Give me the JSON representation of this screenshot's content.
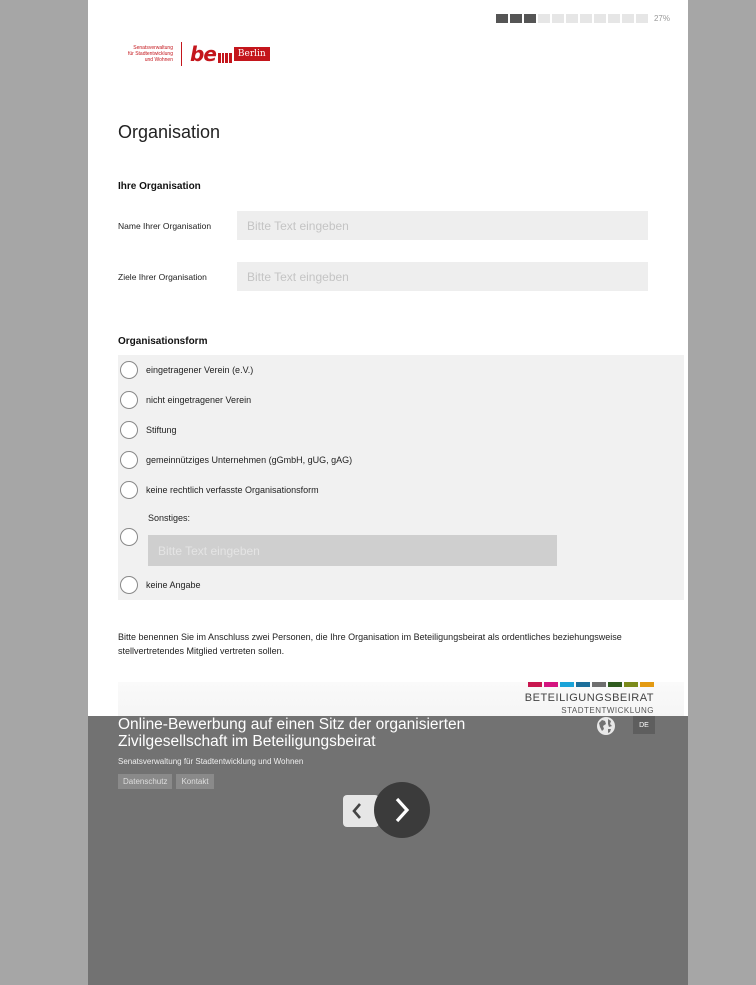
{
  "progress": {
    "percent_label": "27%",
    "segments_total": 11,
    "segments_filled": 3
  },
  "logo": {
    "department_lines": [
      "Senatsverwaltung",
      "für Stadtentwicklung",
      "und Wohnen"
    ],
    "be_text": "be",
    "berlin_text": "Berlin"
  },
  "page_title": "Organisation",
  "org_section": {
    "heading": "Ihre Organisation",
    "name_label": "Name Ihrer Organisation",
    "name_placeholder": "Bitte Text eingeben",
    "goals_label": "Ziele Ihrer Organisation",
    "goals_placeholder": "Bitte Text eingeben"
  },
  "form_section": {
    "heading": "Organisationsform",
    "options": [
      "eingetragener Verein (e.V.)",
      "nicht eingetragener Verein",
      "Stiftung",
      "gemeinnütziges Unternehmen (gGmbH, gUG, gAG)",
      "keine rechtlich verfasste Organisationsform"
    ],
    "other_label": "Sonstiges:",
    "other_placeholder": "Bitte Text eingeben",
    "none_label": "keine Angabe"
  },
  "note": "Bitte benennen Sie im Anschluss zwei Personen, die Ihre Organisation im Beteiligungsbeirat als ordentliches beziehungsweise stellvertretendes Mitglied vertreten sollen.",
  "brand": {
    "main": "BETEILIGUNGSBEIRAT",
    "sub": "STADTENTWICKLUNG",
    "colors": [
      "#c8174f",
      "#d4147f",
      "#1aa3d8",
      "#1c6e9a",
      "#6e6e6e",
      "#2f5b1e",
      "#7a8a1a",
      "#e39a12"
    ]
  },
  "footer": {
    "title": "Online-Bewerbung auf einen Sitz der organisierten Zivilgesellschaft im Beteiligungsbeirat",
    "subtitle": "Senatsverwaltung für Stadtentwicklung und Wohnen",
    "links": [
      "Datenschutz",
      "Kontakt"
    ],
    "language": "DE"
  },
  "colors": {
    "accent_red": "#c4161c",
    "footer_bg": "#727272",
    "nav_dark": "#3b3b3b"
  }
}
